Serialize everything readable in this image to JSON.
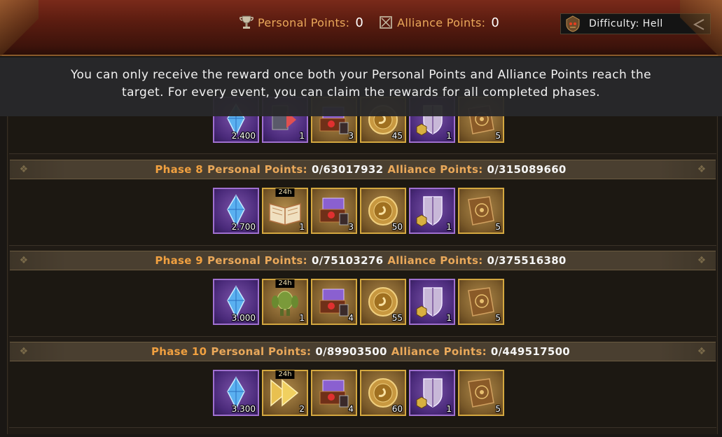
{
  "header": {
    "personal_label": "Personal Points:",
    "personal_value": "0",
    "alliance_label": "Alliance Points:",
    "alliance_value": "0",
    "difficulty": "Difficulty: Hell",
    "icons": [
      "trophy-icon",
      "alliance-flag-icon",
      "skull-helmet-icon",
      "back-arrow-icon"
    ]
  },
  "info": {
    "line1": "You can only receive the reward once both your Personal Points and Alliance Points reach the",
    "line2": "target. For every event, you can claim the rewards for all completed phases."
  },
  "phases": [
    {
      "name": "",
      "rewards": [
        {
          "icon": "crystal-icon",
          "count": "2.400",
          "tier": "purple"
        },
        {
          "icon": "speedup-icon",
          "count": "1",
          "tier": "purple"
        },
        {
          "icon": "hero-chest-icon",
          "count": "3",
          "tier": "gold"
        },
        {
          "icon": "gold-medal-icon",
          "count": "45",
          "tier": "gold"
        },
        {
          "icon": "shield-icon",
          "count": "1",
          "tier": "purple"
        },
        {
          "icon": "tome-icon",
          "count": "5",
          "tier": "gold"
        }
      ]
    },
    {
      "name": "Phase 8",
      "personal_label": "Personal Points:",
      "personal": "0/63017932",
      "alliance_label": "Alliance Points:",
      "alliance": "0/315089660",
      "rewards": [
        {
          "icon": "crystal-icon",
          "count": "2.700",
          "tier": "purple"
        },
        {
          "icon": "open-book-icon",
          "count": "1",
          "tier": "gold",
          "tag": "24h"
        },
        {
          "icon": "hero-chest-icon",
          "count": "3",
          "tier": "gold"
        },
        {
          "icon": "gold-medal-icon",
          "count": "50",
          "tier": "gold"
        },
        {
          "icon": "shield-icon",
          "count": "1",
          "tier": "purple"
        },
        {
          "icon": "tome-icon",
          "count": "5",
          "tier": "gold"
        }
      ]
    },
    {
      "name": "Phase 9",
      "personal_label": "Personal Points:",
      "personal": "0/75103276",
      "alliance_label": "Alliance Points:",
      "alliance": "0/375516380",
      "rewards": [
        {
          "icon": "crystal-icon",
          "count": "3.000",
          "tier": "purple"
        },
        {
          "icon": "cactus-golem-icon",
          "count": "1",
          "tier": "gold",
          "tag": "24h"
        },
        {
          "icon": "hero-chest-icon",
          "count": "4",
          "tier": "gold"
        },
        {
          "icon": "gold-medal-icon",
          "count": "55",
          "tier": "gold"
        },
        {
          "icon": "shield-icon",
          "count": "1",
          "tier": "purple"
        },
        {
          "icon": "tome-icon",
          "count": "5",
          "tier": "gold"
        }
      ]
    },
    {
      "name": "Phase 10",
      "personal_label": "Personal Points:",
      "personal": "0/89903500",
      "alliance_label": "Alliance Points:",
      "alliance": "0/449517500",
      "rewards": [
        {
          "icon": "crystal-icon",
          "count": "3.300",
          "tier": "purple"
        },
        {
          "icon": "speed-arrow-icon",
          "count": "2",
          "tier": "gold",
          "tag": "24h"
        },
        {
          "icon": "hero-chest-icon",
          "count": "4",
          "tier": "gold"
        },
        {
          "icon": "gold-medal-icon",
          "count": "60",
          "tier": "gold"
        },
        {
          "icon": "shield-icon",
          "count": "1",
          "tier": "purple"
        },
        {
          "icon": "tome-icon",
          "count": "5",
          "tier": "gold"
        }
      ]
    }
  ],
  "colors": {
    "accent_orange": "#f0a040",
    "label_orange": "#e9a85a",
    "gold_frame": "#d4a840",
    "purple_frame": "#a070d0"
  }
}
